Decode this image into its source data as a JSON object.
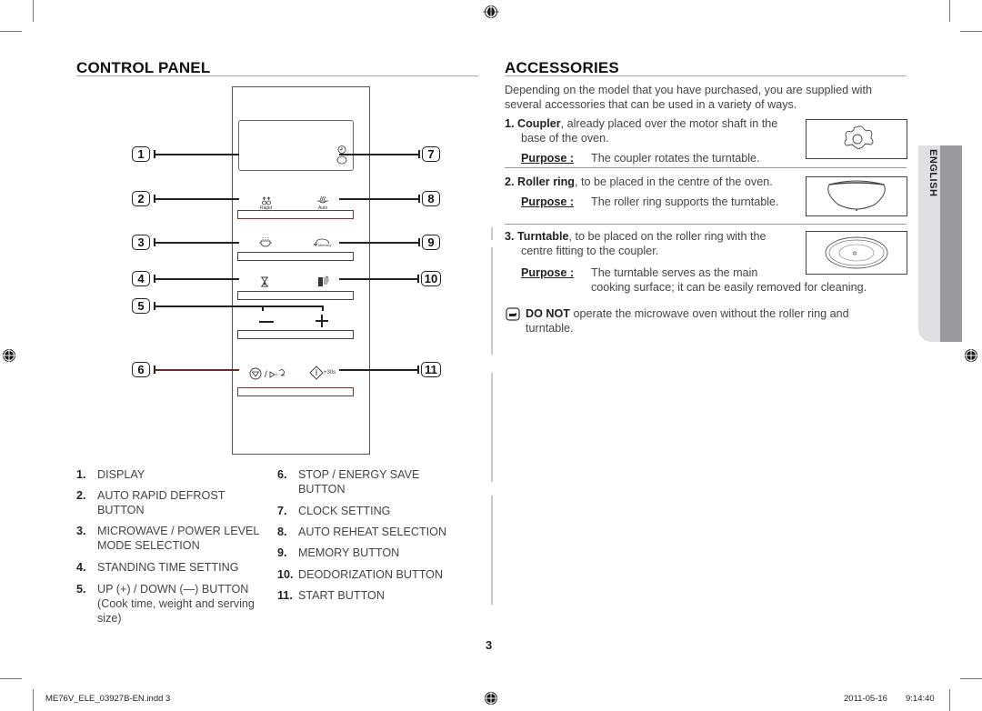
{
  "control_panel": {
    "title": "CONTROL PANEL",
    "callouts": [
      "1",
      "2",
      "3",
      "4",
      "5",
      "6",
      "7",
      "8",
      "9",
      "10",
      "11"
    ],
    "icon_labels": {
      "rapid": "Rapid",
      "auto": "Auto",
      "memory": "Memory",
      "plus30": "+30s",
      "slash": "/"
    },
    "legend_left": [
      {
        "num": "1.",
        "lines": [
          "DISPLAY"
        ]
      },
      {
        "num": "2.",
        "lines": [
          "AUTO RAPID DEFROST",
          "BUTTON"
        ]
      },
      {
        "num": "3.",
        "lines": [
          "MICROWAVE / POWER LEVEL",
          "MODE SELECTION"
        ]
      },
      {
        "num": "4.",
        "lines": [
          "STANDING TIME SETTING"
        ]
      },
      {
        "num": "5.",
        "lines": [
          "UP (+) / DOWN (—) BUTTON",
          "(Cook time, weight and serving",
          "size)"
        ]
      }
    ],
    "legend_right": [
      {
        "num": "6.",
        "lines": [
          "STOP / ENERGY SAVE",
          "BUTTON"
        ]
      },
      {
        "num": "7.",
        "lines": [
          "CLOCK SETTING"
        ]
      },
      {
        "num": "8.",
        "lines": [
          "AUTO REHEAT SELECTION"
        ]
      },
      {
        "num": "9.",
        "lines": [
          "MEMORY BUTTON"
        ]
      },
      {
        "num": "10.",
        "lines": [
          "DEODORIZATION BUTTON"
        ]
      },
      {
        "num": "11.",
        "lines": [
          "START BUTTON"
        ]
      }
    ]
  },
  "accessories": {
    "title": "ACCESSORIES",
    "intro": [
      "Depending on the model that you have purchased, you are supplied with",
      "several accessories that can be used in a variety of ways."
    ],
    "purpose_label": "Purpose :",
    "items": [
      {
        "num": "1.",
        "name": "Coupler",
        "desc_first": ", already placed over the motor shaft in the",
        "desc_more": [
          "base of the oven."
        ],
        "purpose": [
          "The coupler rotates the turntable."
        ]
      },
      {
        "num": "2.",
        "name": "Roller ring",
        "desc_first": ", to be placed in the centre of the oven.",
        "desc_more": [],
        "purpose": [
          "The roller ring supports the turntable."
        ]
      },
      {
        "num": "3.",
        "name": "Turntable",
        "desc_first": ", to be placed on the roller ring with the",
        "desc_more": [
          "centre fitting to the coupler."
        ],
        "purpose": [
          "The turntable serves as the main",
          "cooking surface; it can be easily removed for cleaning."
        ]
      }
    ],
    "note": {
      "bold": "DO NOT",
      "rest": " operate the microwave oven without the roller ring and",
      "line2": "turntable."
    }
  },
  "side_tab": "ENGLISH",
  "page_number": "3",
  "footer": {
    "file": "ME76V_ELE_03927B-EN.indd   3",
    "date": "2011-05-16",
    "time": "9:14:40"
  }
}
